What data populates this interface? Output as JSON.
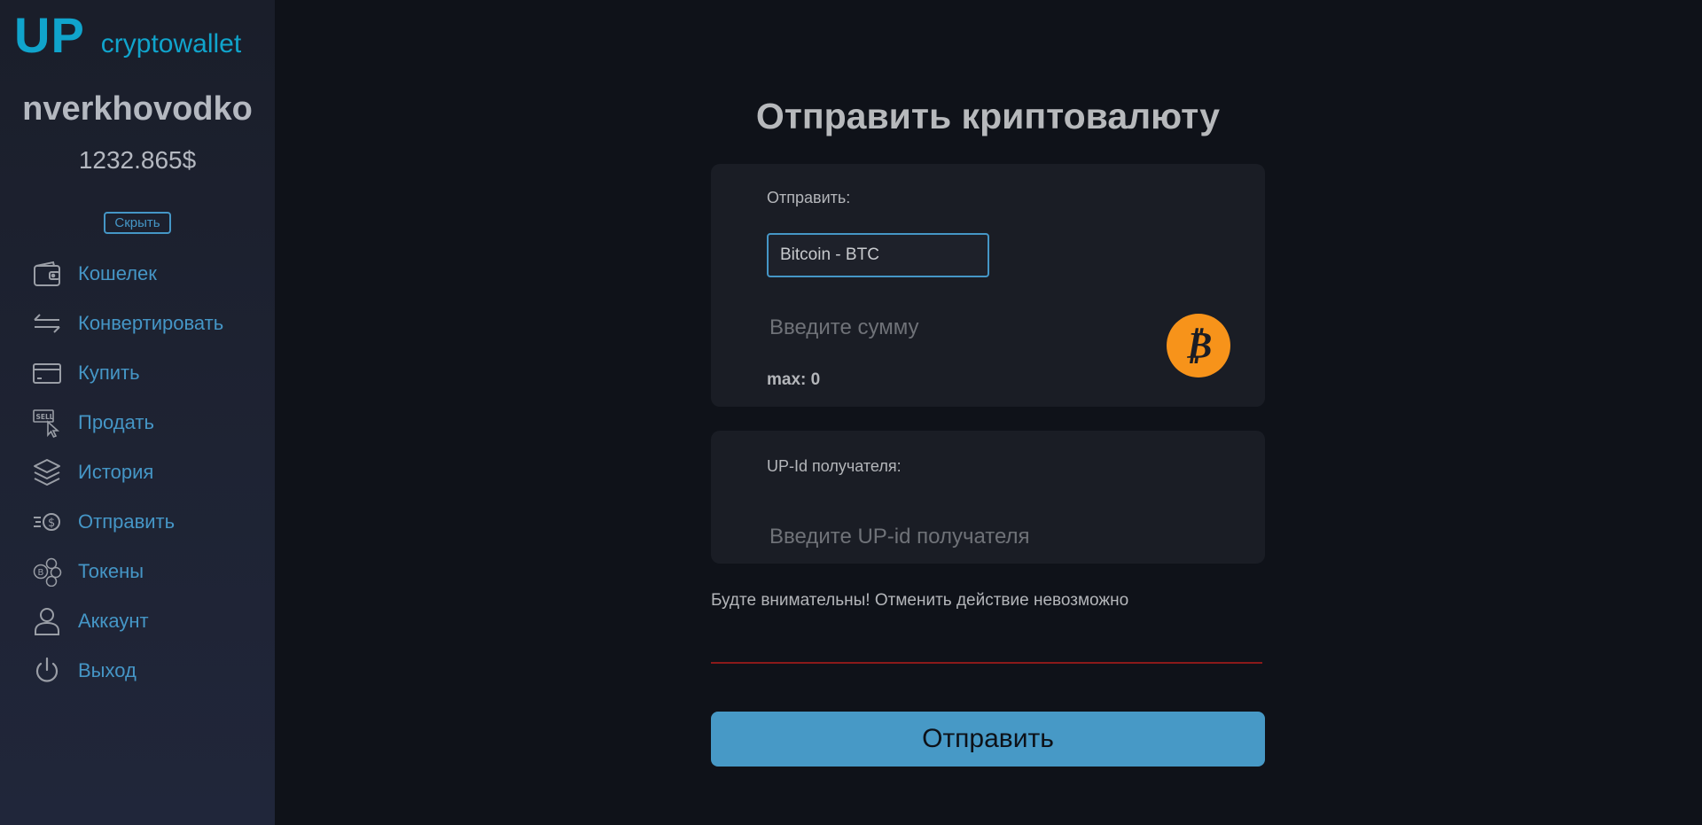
{
  "sidebar": {
    "logo": {
      "brand": "UP",
      "subtitle": "cryptowallet"
    },
    "username": "nverkhovodko",
    "balance": "1232.865$",
    "hide_label": "Скрыть",
    "items": [
      {
        "label": "Кошелек",
        "icon": "wallet-icon"
      },
      {
        "label": "Конвертировать",
        "icon": "arrows-exchange-icon"
      },
      {
        "label": "Купить",
        "icon": "credit-card-icon"
      },
      {
        "label": "Продать",
        "icon": "sell-tag-icon"
      },
      {
        "label": "История",
        "icon": "layers-icon"
      },
      {
        "label": "Отправить",
        "icon": "send-money-icon"
      },
      {
        "label": "Токены",
        "icon": "tokens-icon"
      },
      {
        "label": "Аккаунт",
        "icon": "user-icon"
      },
      {
        "label": "Выход",
        "icon": "power-icon"
      }
    ]
  },
  "main": {
    "title": "Отправить криптовалюту",
    "send_card": {
      "label": "Отправить:",
      "currency_value": "Bitcoin - BTC",
      "amount_placeholder": "Введите сумму",
      "max_label": "max: 0",
      "coin_icon": "bitcoin-icon"
    },
    "recipient_card": {
      "label": "UP-Id получателя:",
      "upid_placeholder": "Введите UP-id получателя"
    },
    "warning": "Будте внимательны! Отменить действие невозможно",
    "submit_label": "Отправить"
  },
  "colors": {
    "accent": "#4596c6",
    "logo": "#10a4cc",
    "bitcoin": "#f7931a",
    "error_line": "#8b1a1a",
    "background": "#0f1219"
  }
}
